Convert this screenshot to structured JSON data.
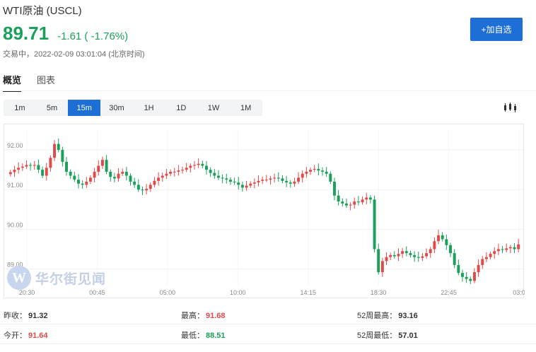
{
  "header": {
    "title": "WTI原油 (USCL)",
    "price": "89.71",
    "change": "-1.61 ( -1.76%)",
    "status": "交易中，2022-02-09 03:01:04 (北京时间)",
    "add_button": "+加自选"
  },
  "tabs": [
    {
      "label": "概览",
      "active": true
    },
    {
      "label": "图表",
      "active": false
    }
  ],
  "periods": [
    "1m",
    "5m",
    "15m",
    "30m",
    "1H",
    "1D",
    "1W",
    "1M"
  ],
  "active_period": "15m",
  "chart_icon": "candlestick-icon",
  "watermark": {
    "logo_letter": "W",
    "text": "华尔街见闻"
  },
  "colors": {
    "up": "#e04a4a",
    "down": "#1aa05a",
    "accent": "#1d6fd6"
  },
  "chart_data": {
    "type": "candlestick",
    "y_ticks": [
      "92.00",
      "91.00",
      "90.00",
      "89.00"
    ],
    "x_ticks": [
      "20:30",
      "00:45",
      "05:00",
      "10:00",
      "14:15",
      "18:30",
      "22:45",
      "03:0"
    ],
    "ylim": [
      88.6,
      92.5
    ],
    "closes": [
      91.44,
      91.5,
      91.55,
      91.58,
      91.62,
      91.6,
      91.62,
      91.5,
      91.35,
      91.55,
      91.8,
      92.15,
      92.0,
      91.7,
      91.45,
      91.35,
      91.25,
      91.15,
      91.12,
      91.2,
      91.3,
      91.45,
      91.6,
      91.75,
      91.45,
      91.32,
      91.28,
      91.4,
      91.45,
      91.35,
      91.2,
      91.12,
      91.0,
      90.98,
      91.02,
      91.12,
      91.22,
      91.3,
      91.35,
      91.4,
      91.45,
      91.45,
      91.48,
      91.5,
      91.55,
      91.6,
      91.62,
      91.65,
      91.6,
      91.5,
      91.42,
      91.35,
      91.3,
      91.28,
      91.25,
      91.2,
      91.18,
      91.12,
      91.05,
      91.1,
      91.15,
      91.18,
      91.22,
      91.25,
      91.25,
      91.28,
      91.3,
      91.28,
      91.22,
      91.18,
      91.15,
      91.2,
      91.3,
      91.4,
      91.45,
      91.5,
      91.52,
      91.48,
      91.45,
      91.4,
      91.2,
      90.85,
      90.7,
      90.65,
      90.6,
      90.62,
      90.7,
      90.68,
      90.75,
      90.8,
      90.75,
      89.5,
      88.92,
      89.2,
      89.3,
      89.35,
      89.32,
      89.38,
      89.45,
      89.4,
      89.35,
      89.3,
      89.28,
      89.32,
      89.4,
      89.5,
      89.7,
      89.85,
      89.75,
      89.6,
      89.4,
      89.1,
      88.9,
      88.8,
      88.75,
      88.7,
      88.92,
      89.1,
      89.25,
      89.3,
      89.38,
      89.45,
      89.5,
      89.48,
      89.52,
      89.55,
      89.5,
      89.62
    ]
  },
  "stats": {
    "prev_close_label": "昨收：",
    "prev_close": "91.32",
    "high_label": "最高：",
    "high": "91.68",
    "w52_high_label": "52周最高：",
    "w52_high": "93.16",
    "open_label": "今开：",
    "open": "91.64",
    "low_label": "最低：",
    "low": "88.51",
    "w52_low_label": "52周最低：",
    "w52_low": "57.01"
  }
}
